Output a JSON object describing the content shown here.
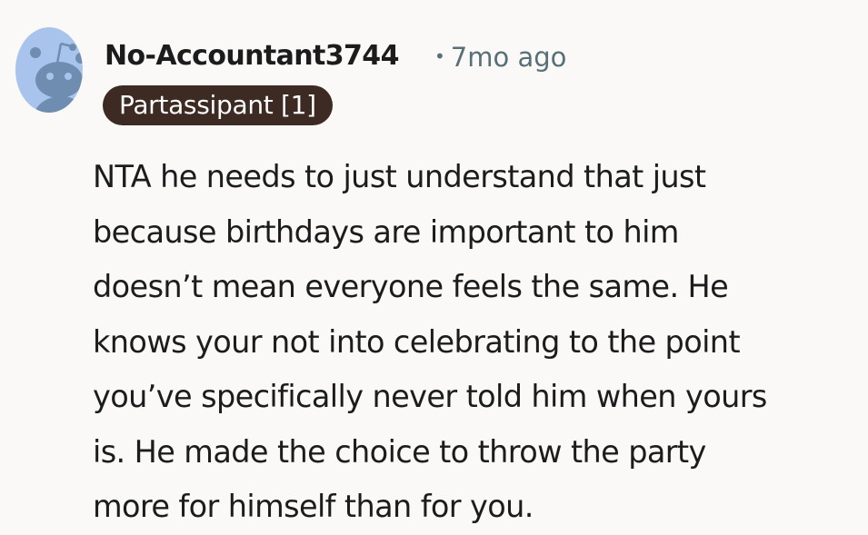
{
  "comment": {
    "username": "No-Accountant3744",
    "separator": "•",
    "timestamp": "7mo ago",
    "flair": "Partassipant [1]",
    "body_lines": [
      "NTA he needs to just understand that just",
      "because birthdays are important to him",
      "doesn’t mean everyone feels the same. He",
      "knows your not into celebrating to the point",
      "you’ve specifically never told him when yours",
      "is. He made the choice to throw the party",
      "more for himself than for you."
    ],
    "avatar_icon": "reddit-snoo-avatar-icon",
    "colors": {
      "avatar_bg": "#a9c4ec",
      "snoo": "#6f8db0",
      "flair_bg": "#3d2a22",
      "meta_text": "#576f76",
      "background": "#faf9f8"
    }
  }
}
